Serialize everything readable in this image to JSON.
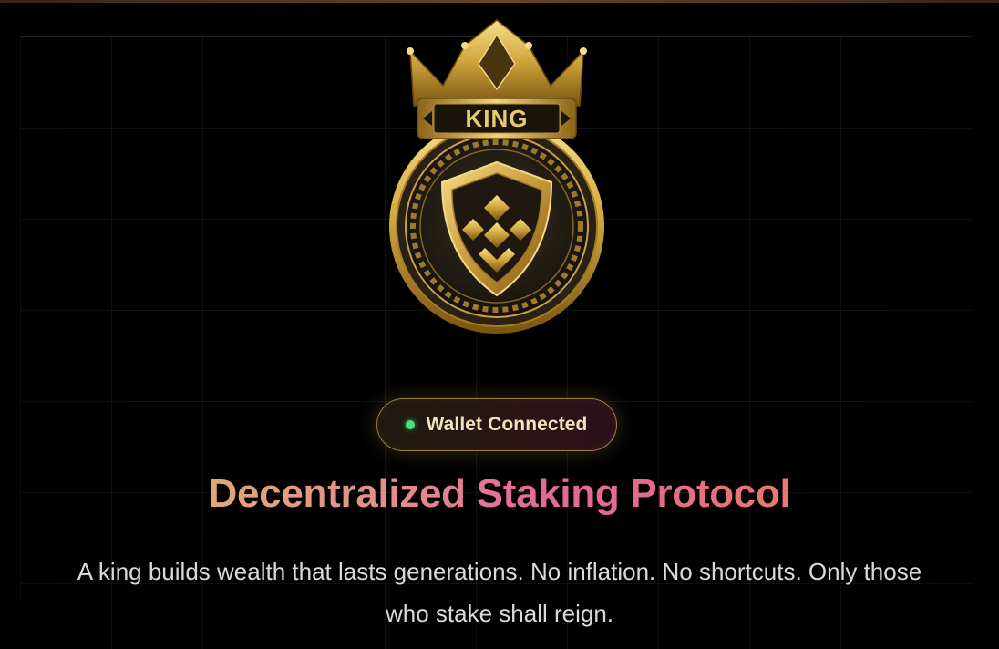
{
  "status": {
    "label": "Wallet Connected",
    "state": "connected",
    "dot_color": "#4ade80"
  },
  "hero": {
    "logo_text": "KING",
    "title": "Decentralized Staking Protocol",
    "tagline": "A king builds wealth that lasts generations. No inflation. No shortcuts. Only those who stake shall reign."
  },
  "colors": {
    "background": "#000000",
    "gold": "#d4a93f",
    "title_gradient_start": "#e1a874",
    "title_gradient_mid": "#e36b9b",
    "title_gradient_end": "#e9796e"
  },
  "icons": {
    "logo": "king-crown-coin-shield-icon",
    "status": "status-dot-icon"
  }
}
